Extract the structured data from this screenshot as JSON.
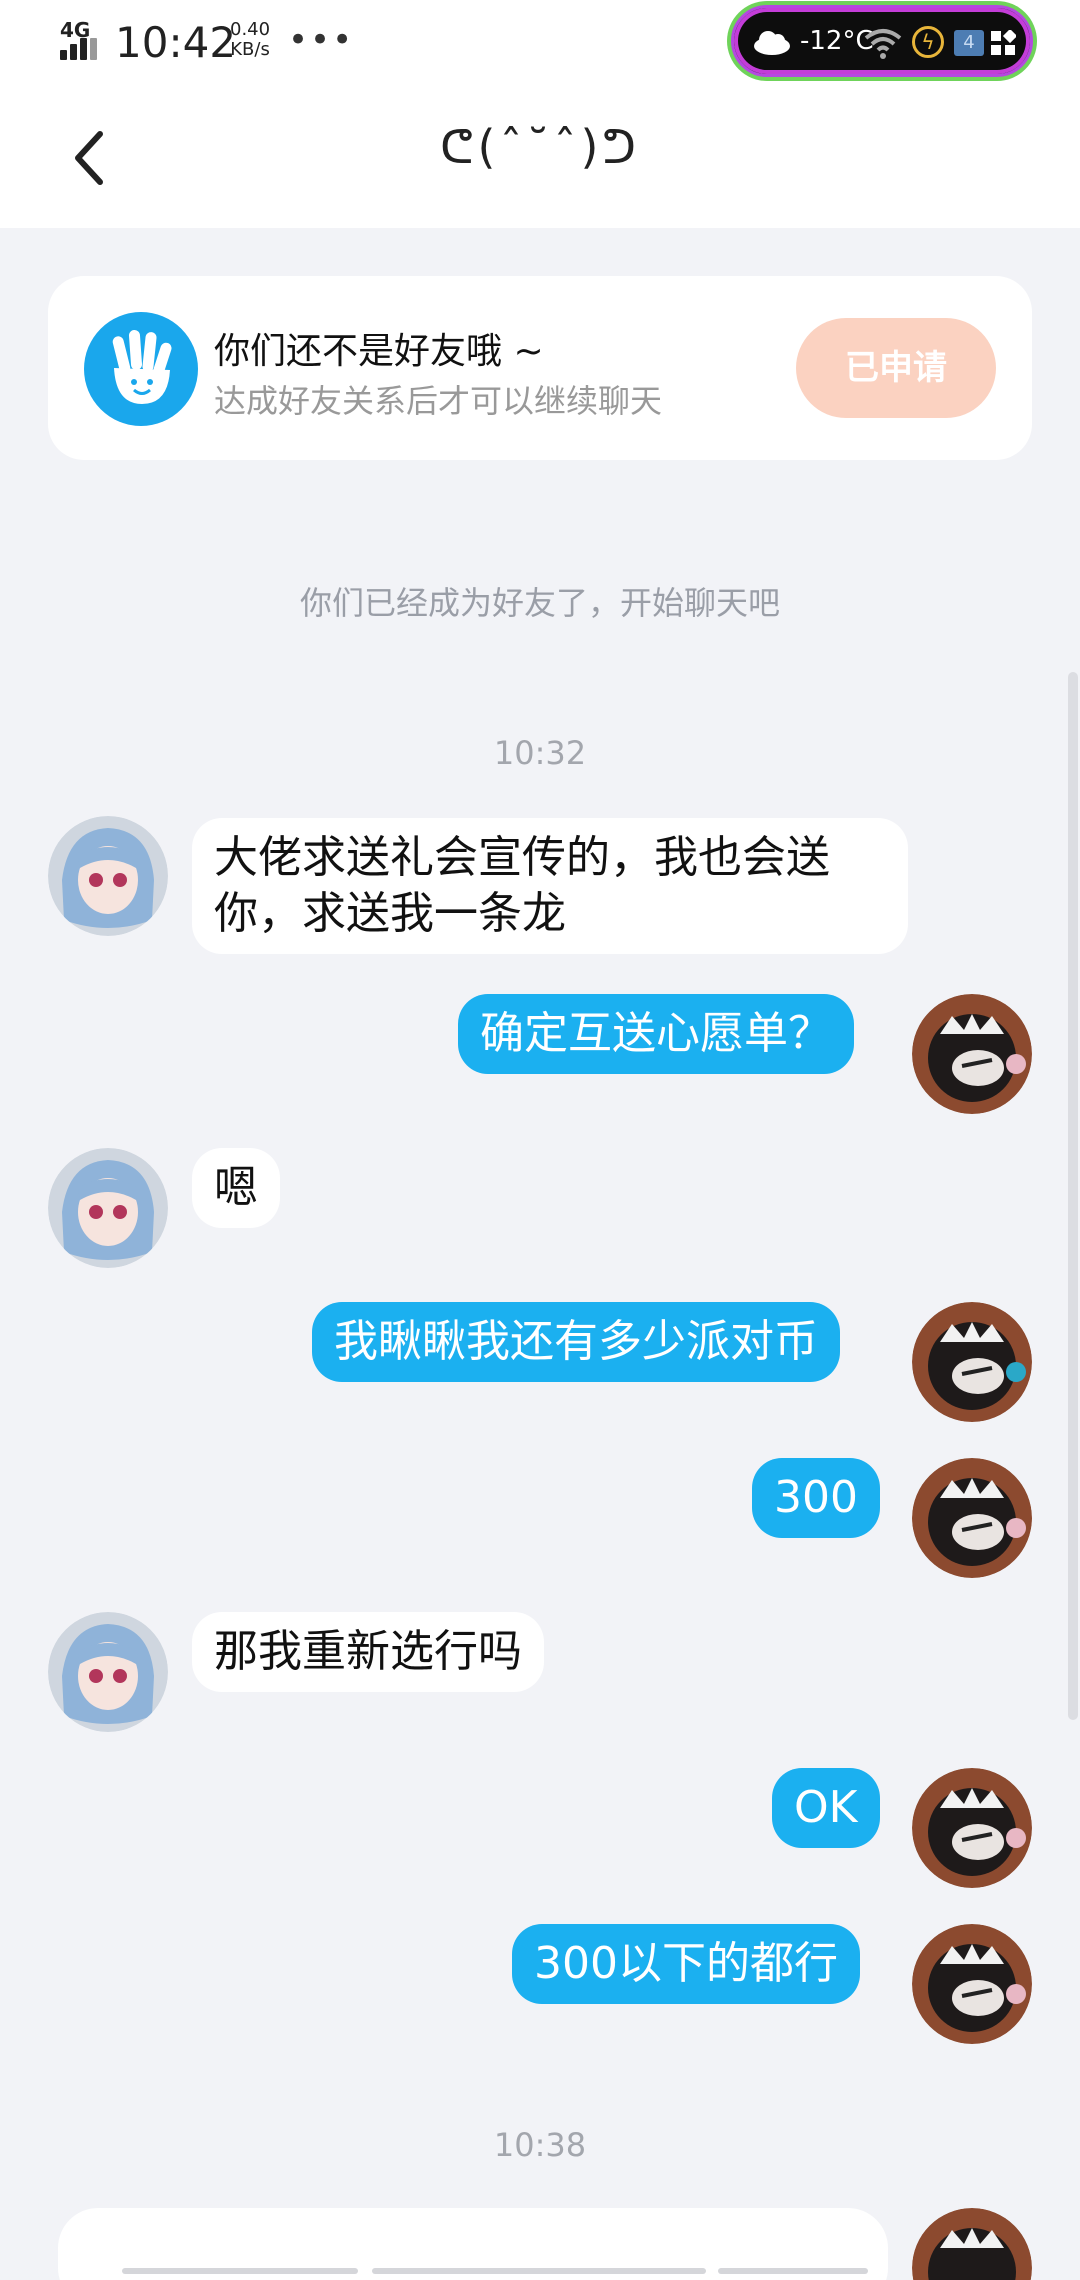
{
  "status_bar": {
    "network": "4G",
    "time": "10:42",
    "speed_value": "0.40",
    "speed_unit": "KB/s",
    "more": "•••",
    "temperature": "-12°C",
    "battery_level": "4"
  },
  "nav": {
    "title": "ᕦ(ˆ˘ˆ)ᕤ",
    "back_icon": "chevron-left-icon"
  },
  "friend_card": {
    "title": "你们还不是好友哦 ~",
    "subtitle": "达成好友关系后才可以继续聊天",
    "button_label": "已申请",
    "icon": "hand-wave-icon"
  },
  "system_message": "你们已经成为好友了，开始聊天吧",
  "timestamps": [
    "10:32",
    "10:38"
  ],
  "messages": [
    {
      "side": "left",
      "text_lines": [
        "大佬求送礼会宣传的，我也会送",
        "你，求送我一条龙"
      ]
    },
    {
      "side": "right",
      "text_lines": [
        "确定互送心愿单？"
      ]
    },
    {
      "side": "left",
      "text_lines": [
        "嗯"
      ]
    },
    {
      "side": "right",
      "text_lines": [
        "我瞅瞅我还有多少派对币"
      ]
    },
    {
      "side": "right",
      "text_lines": [
        "300"
      ]
    },
    {
      "side": "left",
      "text_lines": [
        "那我重新选行吗"
      ]
    },
    {
      "side": "right",
      "text_lines": [
        "OK"
      ]
    },
    {
      "side": "right",
      "text_lines": [
        "300以下的都行"
      ]
    }
  ],
  "colors": {
    "accent_blue": "#1bb0f0",
    "applied_button": "#fbd2c1",
    "background": "#f2f3f7"
  }
}
